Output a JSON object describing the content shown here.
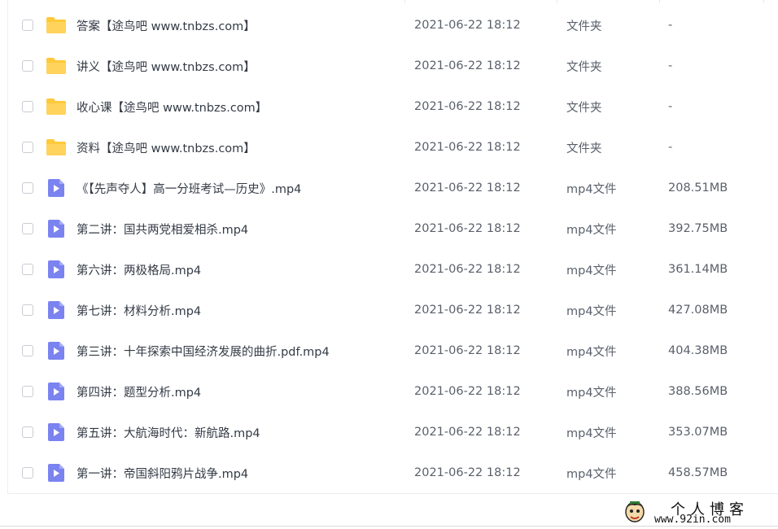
{
  "files": [
    {
      "name": "答案【途鸟吧 www.tnbzs.com】",
      "time": "2021-06-22 18:12",
      "type": "文件夹",
      "size": "-",
      "icon": "folder-icon"
    },
    {
      "name": "讲义【途鸟吧 www.tnbzs.com】",
      "time": "2021-06-22 18:12",
      "type": "文件夹",
      "size": "-",
      "icon": "folder-icon"
    },
    {
      "name": "收心课【途鸟吧 www.tnbzs.com】",
      "time": "2021-06-22 18:12",
      "type": "文件夹",
      "size": "-",
      "icon": "folder-icon"
    },
    {
      "name": "资料【途鸟吧 www.tnbzs.com】",
      "time": "2021-06-22 18:12",
      "type": "文件夹",
      "size": "-",
      "icon": "folder-icon"
    },
    {
      "name": "《【先声夺人】高一分班考试—历史》.mp4",
      "time": "2021-06-22 18:12",
      "type": "mp4文件",
      "size": "208.51MB",
      "icon": "video-file-icon"
    },
    {
      "name": "第二讲：国共两党相爱相杀.mp4",
      "time": "2021-06-22 18:12",
      "type": "mp4文件",
      "size": "392.75MB",
      "icon": "video-file-icon"
    },
    {
      "name": "第六讲：两极格局.mp4",
      "time": "2021-06-22 18:12",
      "type": "mp4文件",
      "size": "361.14MB",
      "icon": "video-file-icon"
    },
    {
      "name": "第七讲：材料分析.mp4",
      "time": "2021-06-22 18:12",
      "type": "mp4文件",
      "size": "427.08MB",
      "icon": "video-file-icon"
    },
    {
      "name": "第三讲：十年探索中国经济发展的曲折.pdf.mp4",
      "time": "2021-06-22 18:12",
      "type": "mp4文件",
      "size": "404.38MB",
      "icon": "video-file-icon"
    },
    {
      "name": "第四讲：题型分析.mp4",
      "time": "2021-06-22 18:12",
      "type": "mp4文件",
      "size": "388.56MB",
      "icon": "video-file-icon"
    },
    {
      "name": "第五讲：大航海时代：新航路.mp4",
      "time": "2021-06-22 18:12",
      "type": "mp4文件",
      "size": "353.07MB",
      "icon": "video-file-icon"
    },
    {
      "name": "第一讲：帝国斜阳鸦片战争.mp4",
      "time": "2021-06-22 18:12",
      "type": "mp4文件",
      "size": "458.57MB",
      "icon": "video-file-icon"
    }
  ],
  "watermark": {
    "title": "个人博客",
    "url": "www.92in.com"
  },
  "colors": {
    "folder": "#ffc93c",
    "video": "#7b83f0",
    "text": "#333a45",
    "muted": "#5a606b"
  }
}
